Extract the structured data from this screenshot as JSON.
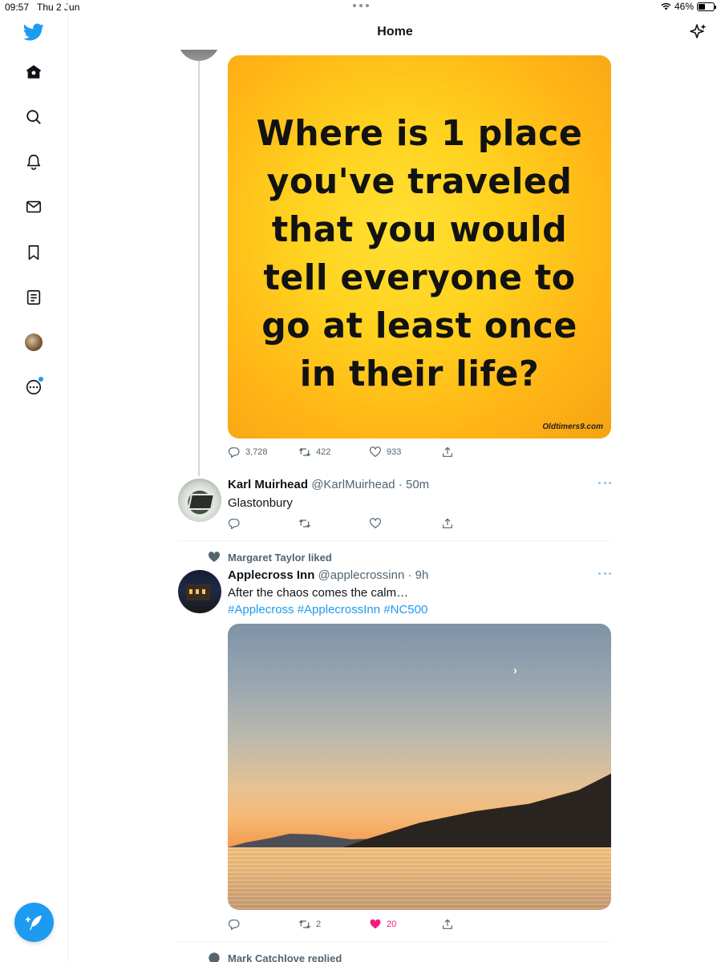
{
  "status_bar": {
    "time": "09:57",
    "date": "Thu 2 Jun",
    "battery": "46%",
    "battery_level": 0.46
  },
  "header": {
    "title": "Home"
  },
  "sidebar": {
    "items": [
      {
        "name": "home",
        "icon": "home-icon"
      },
      {
        "name": "explore",
        "icon": "search-icon"
      },
      {
        "name": "notifications",
        "icon": "bell-icon"
      },
      {
        "name": "messages",
        "icon": "mail-icon"
      },
      {
        "name": "bookmarks",
        "icon": "bookmark-icon"
      },
      {
        "name": "lists",
        "icon": "list-icon"
      },
      {
        "name": "profile",
        "icon": "avatar"
      },
      {
        "name": "more",
        "icon": "more-circle-icon"
      }
    ]
  },
  "tweets": [
    {
      "image_text_lines": [
        "Where is 1 place",
        "you've traveled",
        "that you would",
        "tell everyone to",
        "go at least once",
        "in their life?"
      ],
      "image_watermark": "Oldtimers9.com",
      "replies": "3,728",
      "retweets": "422",
      "likes": "933"
    },
    {
      "name": "Karl Muirhead",
      "handle": "@KarlMuirhead",
      "time": "50m",
      "text": "Glastonbury"
    },
    {
      "context": "Margaret Taylor liked",
      "name": "Applecross Inn",
      "handle": "@applecrossinn",
      "time": "9h",
      "text": "After the chaos comes the calm…",
      "hashtags": "#Applecross #ApplecrossInn #NC500",
      "retweets": "2",
      "likes": "20"
    },
    {
      "context": "Mark Catchlove replied"
    }
  ],
  "colors": {
    "accent": "#1d9bf0",
    "like": "#f91880",
    "muted": "#536471"
  }
}
